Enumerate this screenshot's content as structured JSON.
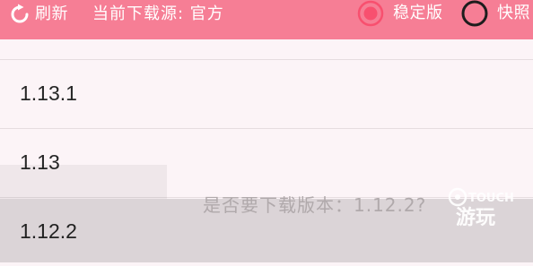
{
  "toolbar": {
    "refresh_icon": "refresh-icon",
    "refresh_label": "刷新",
    "source_label": "当前下载源: 官方",
    "options": [
      {
        "label": "稳定版",
        "selected": true
      },
      {
        "label": "快照",
        "selected": false
      }
    ]
  },
  "versions": [
    {
      "label": "1.13.1"
    },
    {
      "label": "1.13"
    },
    {
      "label": "1.12.2"
    }
  ],
  "dialog": {
    "prompt": "是否要下载版本：1.12.2?"
  },
  "watermark": {
    "top_text": "TOUCH",
    "bottom_text": "游玩"
  },
  "colors": {
    "toolbar_bg": "#f67e95",
    "radio_selected": "#f8506f",
    "list_bg": "#fcf4f7"
  }
}
